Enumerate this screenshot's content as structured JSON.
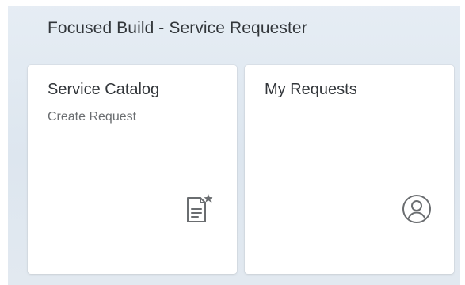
{
  "group": {
    "title": "Focused Build - Service Requester"
  },
  "tiles": [
    {
      "title": "Service Catalog",
      "subtitle": "Create Request",
      "icon": "document-star-icon"
    },
    {
      "title": "My Requests",
      "subtitle": "",
      "icon": "user-circle-icon"
    }
  ],
  "colors": {
    "icon": "#6a6d70",
    "text": "#32363a",
    "subtext": "#6a6d70",
    "tile_background": "#ffffff",
    "page_background": "#e2e9f0"
  }
}
